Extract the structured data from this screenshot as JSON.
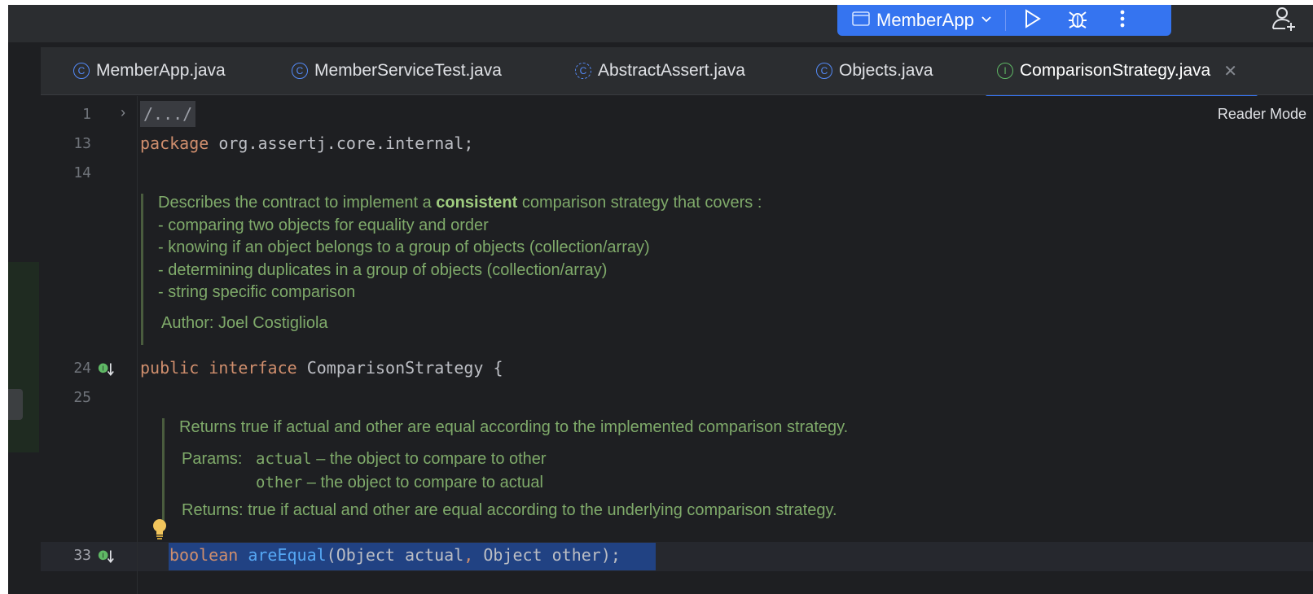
{
  "titlebar": {
    "run_config": "MemberApp"
  },
  "tabs": [
    {
      "label": "MemberApp.java",
      "icon": "class-icon"
    },
    {
      "label": "MemberServiceTest.java",
      "icon": "class-icon"
    },
    {
      "label": "AbstractAssert.java",
      "icon": "abstract-class-icon"
    },
    {
      "label": "Objects.java",
      "icon": "class-icon"
    },
    {
      "label": "ComparisonStrategy.java",
      "icon": "interface-icon"
    }
  ],
  "editor": {
    "reader_mode": "Reader Mode",
    "line_numbers": [
      "1",
      "13",
      "14",
      "24",
      "25",
      "33"
    ],
    "folded_header": "/.../",
    "package_kw": "package",
    "package_name": " org.assertj.core.internal;",
    "interface_kw1": "public",
    "interface_kw2": "interface",
    "interface_rest": " ComparisonStrategy {",
    "method_kw": "boolean",
    "method_name": "areEqual",
    "method_open": "(Object actual",
    "method_comma": ",",
    "method_rest": " Object other);",
    "doc1": {
      "intro_pre": "Describes the contract to implement a ",
      "intro_bold": "consistent",
      "intro_post": " comparison strategy that covers :",
      "items": [
        "- comparing two objects for equality and order",
        "- knowing if an object belongs to a group of objects (collection/array)",
        "- determining duplicates in a group of objects (collection/array)",
        "- string specific comparison"
      ],
      "author_label": "Author:",
      "author_value": "Joel Costigliola"
    },
    "doc2": {
      "summary": "Returns true if actual and other are equal according to the implemented comparison strategy.",
      "params_label": "Params:",
      "param1_name": "actual",
      "param1_desc": " – the object to compare to other",
      "param2_name": "other",
      "param2_desc": " – the object to compare to actual",
      "returns_label": "Returns:",
      "returns_value": "true if actual and other are equal according to the underlying comparison strategy."
    }
  },
  "colors": {
    "accent": "#3574f0",
    "keyword": "#cf8e6d",
    "doc_text": "#7faa6a",
    "selection": "#214283"
  }
}
